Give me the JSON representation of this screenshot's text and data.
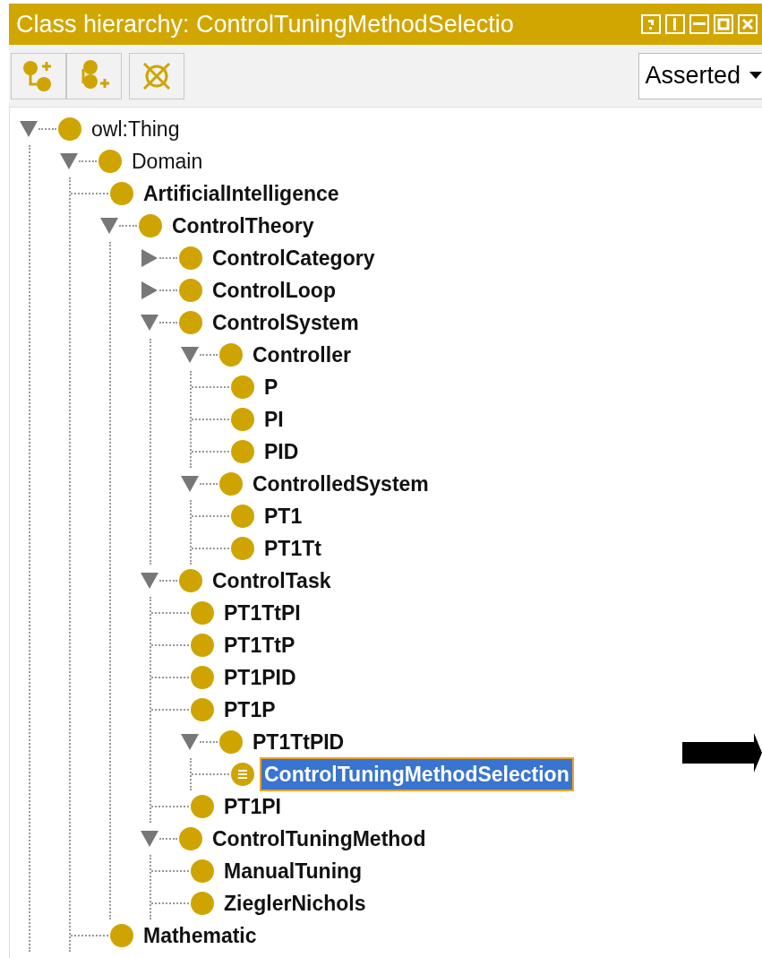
{
  "window": {
    "title": "Class hierarchy: ControlTuningMethodSelectio"
  },
  "toolbar": {
    "view_select": {
      "value": "Asserted"
    }
  },
  "tree": [
    {
      "label": "owl:Thing",
      "kind": "branch",
      "expanded": true,
      "bold": false,
      "defined": false,
      "selected": false,
      "children": [
        {
          "label": "Domain",
          "kind": "branch",
          "expanded": true,
          "bold": false,
          "defined": false,
          "selected": false,
          "children": [
            {
              "label": "ArtificialIntelligence",
              "kind": "leaf",
              "bold": true,
              "defined": false,
              "selected": false
            },
            {
              "label": "ControlTheory",
              "kind": "branch",
              "expanded": true,
              "bold": true,
              "defined": false,
              "selected": false,
              "children": [
                {
                  "label": "ControlCategory",
                  "kind": "branch",
                  "expanded": false,
                  "bold": true,
                  "defined": false,
                  "selected": false
                },
                {
                  "label": "ControlLoop",
                  "kind": "branch",
                  "expanded": false,
                  "bold": true,
                  "defined": false,
                  "selected": false
                },
                {
                  "label": "ControlSystem",
                  "kind": "branch",
                  "expanded": true,
                  "bold": true,
                  "defined": false,
                  "selected": false,
                  "children": [
                    {
                      "label": "Controller",
                      "kind": "branch",
                      "expanded": true,
                      "bold": true,
                      "defined": false,
                      "selected": false,
                      "children": [
                        {
                          "label": "P",
                          "kind": "leaf",
                          "bold": true,
                          "defined": false,
                          "selected": false
                        },
                        {
                          "label": "PI",
                          "kind": "leaf",
                          "bold": true,
                          "defined": false,
                          "selected": false
                        },
                        {
                          "label": "PID",
                          "kind": "leaf",
                          "bold": true,
                          "defined": false,
                          "selected": false
                        }
                      ]
                    },
                    {
                      "label": "ControlledSystem",
                      "kind": "branch",
                      "expanded": true,
                      "bold": true,
                      "defined": false,
                      "selected": false,
                      "children": [
                        {
                          "label": "PT1",
                          "kind": "leaf",
                          "bold": true,
                          "defined": false,
                          "selected": false
                        },
                        {
                          "label": "PT1Tt",
                          "kind": "leaf",
                          "bold": true,
                          "defined": false,
                          "selected": false
                        }
                      ]
                    }
                  ]
                },
                {
                  "label": "ControlTask",
                  "kind": "branch",
                  "expanded": true,
                  "bold": true,
                  "defined": false,
                  "selected": false,
                  "children": [
                    {
                      "label": "PT1TtPI",
                      "kind": "leaf",
                      "bold": true,
                      "defined": false,
                      "selected": false
                    },
                    {
                      "label": "PT1TtP",
                      "kind": "leaf",
                      "bold": true,
                      "defined": false,
                      "selected": false
                    },
                    {
                      "label": "PT1PID",
                      "kind": "leaf",
                      "bold": true,
                      "defined": false,
                      "selected": false
                    },
                    {
                      "label": "PT1P",
                      "kind": "leaf",
                      "bold": true,
                      "defined": false,
                      "selected": false
                    },
                    {
                      "label": "PT1TtPID",
                      "kind": "branch",
                      "expanded": true,
                      "bold": true,
                      "defined": false,
                      "selected": false,
                      "children": [
                        {
                          "label": "ControlTuningMethodSelection",
                          "kind": "leaf",
                          "bold": true,
                          "defined": true,
                          "selected": true
                        }
                      ]
                    },
                    {
                      "label": "PT1PI",
                      "kind": "leaf",
                      "bold": true,
                      "defined": false,
                      "selected": false
                    }
                  ]
                },
                {
                  "label": "ControlTuningMethod",
                  "kind": "branch",
                  "expanded": true,
                  "bold": true,
                  "defined": false,
                  "selected": false,
                  "children": [
                    {
                      "label": "ManualTuning",
                      "kind": "leaf",
                      "bold": true,
                      "defined": false,
                      "selected": false
                    },
                    {
                      "label": "ZieglerNichols",
                      "kind": "leaf",
                      "bold": true,
                      "defined": false,
                      "selected": false
                    }
                  ]
                }
              ]
            },
            {
              "label": "Mathematic",
              "kind": "leaf",
              "bold": true,
              "defined": false,
              "selected": false
            }
          ]
        }
      ]
    }
  ]
}
